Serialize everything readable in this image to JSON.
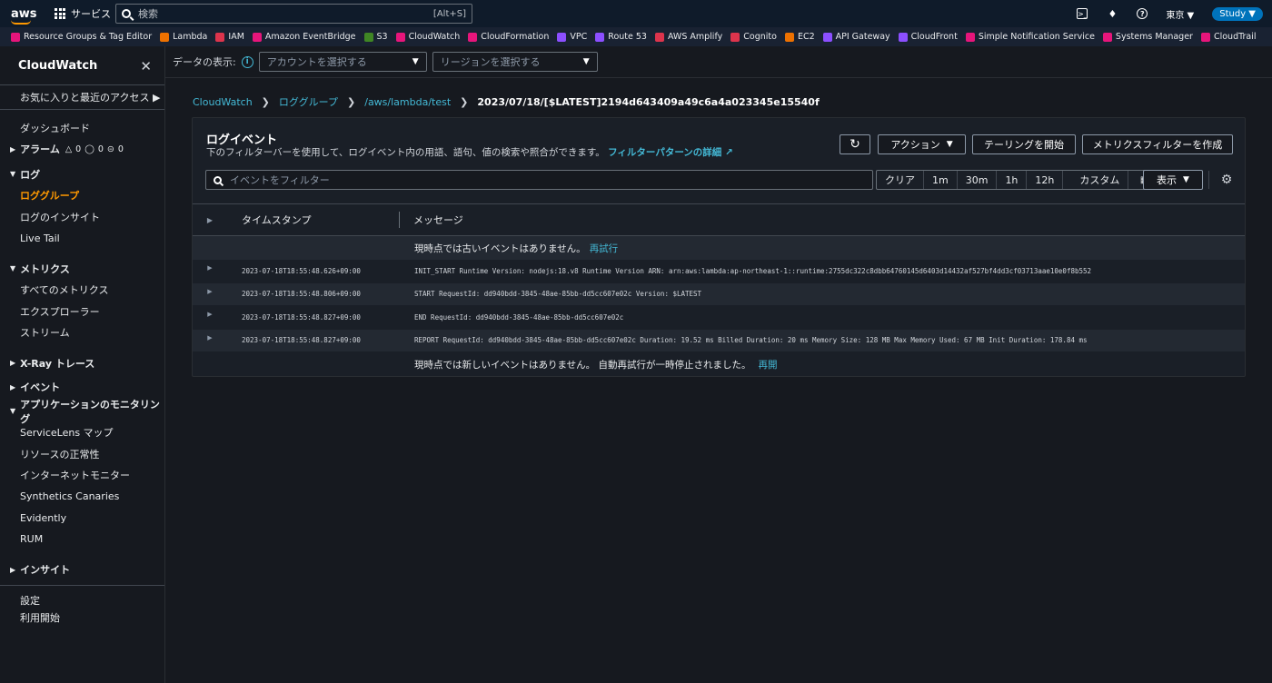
{
  "topbar": {
    "logo": "aws",
    "services_label": "サービス",
    "search_placeholder": "検索",
    "search_shortcut": "[Alt+S]",
    "region": "東京 ▼",
    "account": "Study ▼"
  },
  "favorites": [
    {
      "label": "Resource Groups & Tag Editor",
      "color": "#e7157b"
    },
    {
      "label": "Lambda",
      "color": "#ed7100"
    },
    {
      "label": "IAM",
      "color": "#dd344c"
    },
    {
      "label": "Amazon EventBridge",
      "color": "#e7157b"
    },
    {
      "label": "S3",
      "color": "#3f8624"
    },
    {
      "label": "CloudWatch",
      "color": "#e7157b"
    },
    {
      "label": "CloudFormation",
      "color": "#e7157b"
    },
    {
      "label": "VPC",
      "color": "#8c4fff"
    },
    {
      "label": "Route 53",
      "color": "#8c4fff"
    },
    {
      "label": "AWS Amplify",
      "color": "#dd344c"
    },
    {
      "label": "Cognito",
      "color": "#dd344c"
    },
    {
      "label": "EC2",
      "color": "#ed7100"
    },
    {
      "label": "API Gateway",
      "color": "#8c4fff"
    },
    {
      "label": "CloudFront",
      "color": "#8c4fff"
    },
    {
      "label": "Simple Notification Service",
      "color": "#e7157b"
    },
    {
      "label": "Systems Manager",
      "color": "#e7157b"
    },
    {
      "label": "CloudTrail",
      "color": "#e7157b"
    }
  ],
  "sidebar": {
    "title": "CloudWatch",
    "favorites": "お気に入りと最近のアクセス ▶",
    "dashboard": "ダッシュボード",
    "alarm_section": "アラーム",
    "alarm_counts": [
      "0",
      "0",
      "0"
    ],
    "log_section": "ログ",
    "log_items": [
      "ロググループ",
      "ログのインサイト",
      "Live Tail"
    ],
    "metrics_section": "メトリクス",
    "metrics_items": [
      "すべてのメトリクス",
      "エクスプローラー",
      "ストリーム"
    ],
    "xray_section": "X-Ray トレース",
    "events_section": "イベント",
    "appmon_section": "アプリケーションのモニタリング",
    "appmon_items": [
      "ServiceLens マップ",
      "リソースの正常性",
      "インターネットモニター",
      "Synthetics Canaries",
      "Evidently",
      "RUM"
    ],
    "insights_section": "インサイト",
    "footer_items": [
      "設定",
      "利用開始"
    ]
  },
  "controls": {
    "data_display": "データの表示:",
    "account_placeholder": "アカウントを選択する",
    "region_placeholder": "リージョンを選択する"
  },
  "breadcrumb": {
    "items": [
      "CloudWatch",
      "ロググループ",
      "/aws/lambda/test"
    ],
    "current": "2023/07/18/[$LATEST]2194d643409a49c6a4a023345e15540f"
  },
  "panel": {
    "title": "ログイベント",
    "description": "下のフィルターバーを使用して、ログイベント内の用語、語句、値の検索や照合ができます。",
    "learn_link": "フィルターパターンの詳細",
    "actions": "アクション",
    "tailing": "テーリングを開始",
    "metric_filter": "メトリクスフィルターを作成",
    "filter_placeholder": "イベントをフィルター",
    "time_options": [
      "クリア",
      "1m",
      "30m",
      "1h",
      "12h"
    ],
    "custom": "カスタム",
    "display": "表示"
  },
  "table": {
    "col_timestamp": "タイムスタンプ",
    "col_message": "メッセージ",
    "note_older": "現時点では古いイベントはありません。",
    "retry": "再試行",
    "events": [
      {
        "timestamp": "2023-07-18T18:55:48.626+09:00",
        "message": "INIT_START Runtime Version: nodejs:18.v8 Runtime Version ARN: arn:aws:lambda:ap-northeast-1::runtime:2755dc322c8dbb64760145d6403d14432af527bf4dd3cf03713aae10e0f8b552"
      },
      {
        "timestamp": "2023-07-18T18:55:48.806+09:00",
        "message": "START RequestId: dd940bdd-3845-48ae-85bb-dd5cc607e02c Version: $LATEST"
      },
      {
        "timestamp": "2023-07-18T18:55:48.827+09:00",
        "message": "END RequestId: dd940bdd-3845-48ae-85bb-dd5cc607e02c"
      },
      {
        "timestamp": "2023-07-18T18:55:48.827+09:00",
        "message": "REPORT RequestId: dd940bdd-3845-48ae-85bb-dd5cc607e02c Duration: 19.52 ms Billed Duration: 20 ms Memory Size: 128 MB Max Memory Used: 67 MB Init Duration: 178.84 ms"
      }
    ],
    "note_newer": "現時点では新しいイベントはありません。 自動再試行が一時停止されました。",
    "resume": "再開"
  }
}
